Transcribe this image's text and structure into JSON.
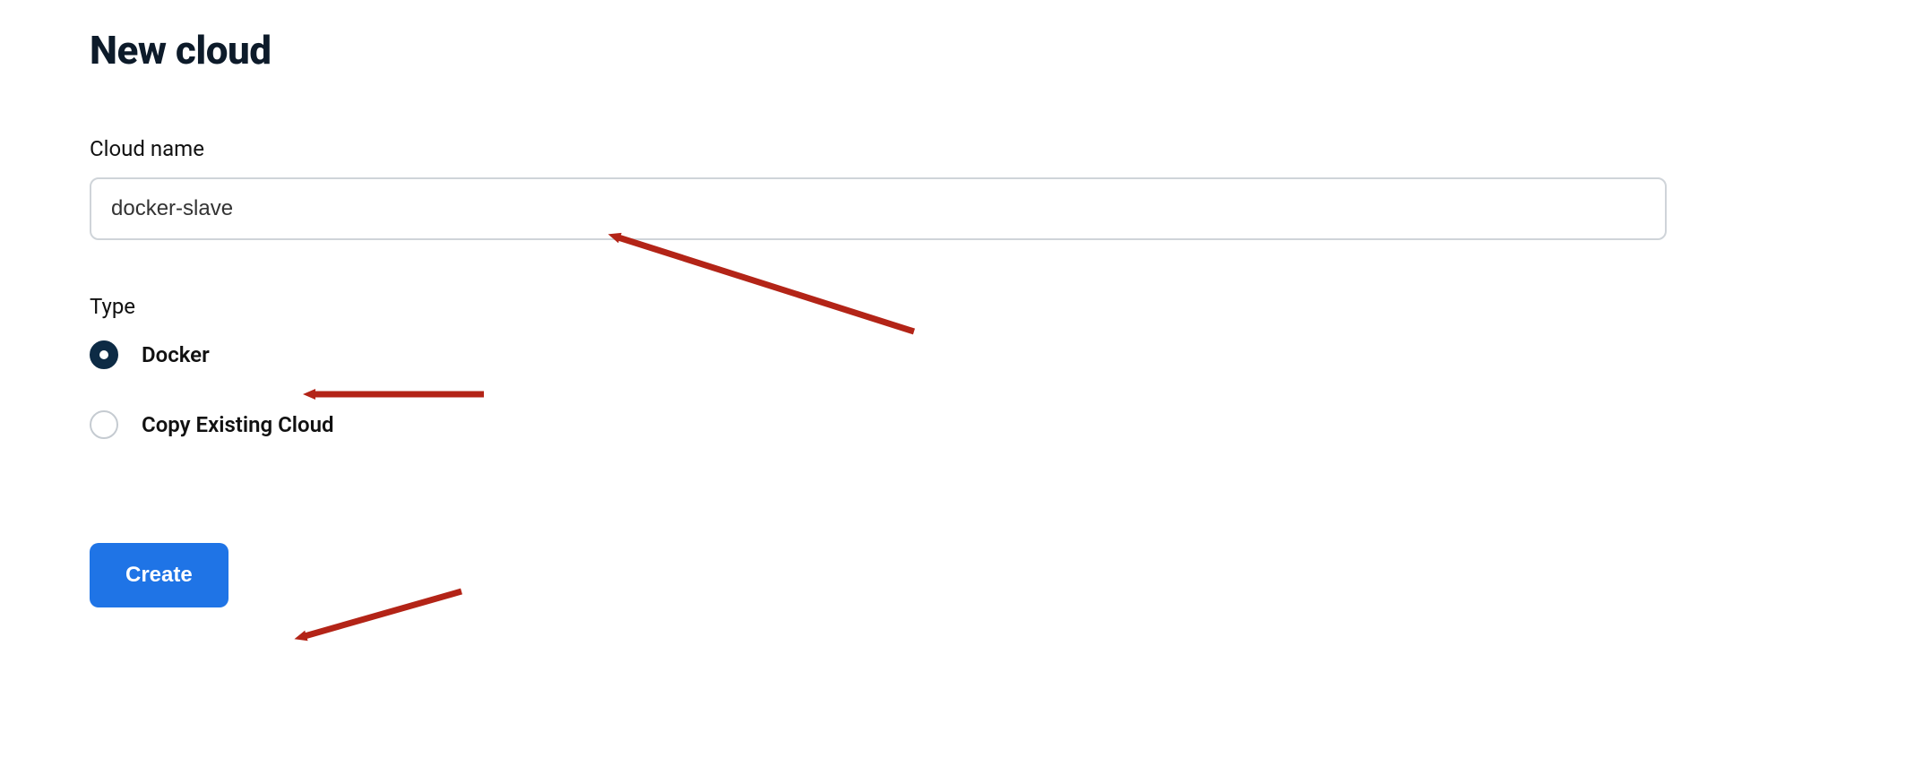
{
  "page": {
    "title": "New cloud"
  },
  "form": {
    "cloud_name_label": "Cloud name",
    "cloud_name_value": "docker-slave",
    "type_label": "Type",
    "options": [
      {
        "label": "Docker",
        "selected": true
      },
      {
        "label": "Copy Existing Cloud",
        "selected": false
      }
    ],
    "submit_label": "Create"
  },
  "annotations": {
    "arrow_color": "#b32417"
  }
}
